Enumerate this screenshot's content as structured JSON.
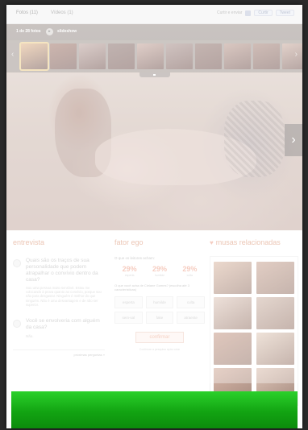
{
  "tabs": {
    "photos": "Fotos (11)",
    "videos": "Vídeos (1)"
  },
  "share": {
    "label": "Curtir e enviar",
    "like": "Curtir",
    "share": "Tweet"
  },
  "gallery": {
    "counter": "1 de 28 fotos",
    "slideshow": "slideshow",
    "prev_icon": "chevron-left-icon",
    "next_icon": "chevron-right-icon",
    "thumb_colors": [
      "#e8c29d",
      "#b28e83",
      "#c7b2ad",
      "#9f8a86",
      "#cfb4ab",
      "#b7a39f",
      "#a58d87",
      "#c6aaa0",
      "#b79a90",
      "#d3b9ae"
    ]
  },
  "interview": {
    "title": "entrevista",
    "q1": "Quais são os traços de sua personalidade que podem atrapalhar o convívio dentro da casa?",
    "a1": "Sou uma pessoa muito sensível. Estou me colocando à prova quanto ao convívio, porque sou não para desgastar. Ninguém é melhor do que ninguém. Não é uma desvantagem e de não ser superior.",
    "q2": "Você se envolveria com alguém da casa?",
    "a2": "Não.",
    "footer_left": "",
    "footer_link": "próximas perguntas »"
  },
  "ego": {
    "title": "fator ego",
    "question": "O que os leitores acham:",
    "pcts": [
      {
        "value": "29%",
        "label": "esperta"
      },
      {
        "value": "29%",
        "label": "humilde"
      },
      {
        "value": "29%",
        "label": "culta"
      }
    ],
    "question2": "O que você acha de Cleiane Gomes? (escolha até 3 características)",
    "options": [
      "esperta",
      "humilde",
      "culta",
      "sem-sal",
      "fake",
      "atraente"
    ],
    "confirm": "confirmar",
    "note": "Continuar a pesquisa após votar"
  },
  "musas": {
    "title": "musas relacionadas",
    "thumb_colors": [
      "#e1c4b2",
      "#d2b3a4",
      "#e4d0c5",
      "#d6c1b5",
      "#cfa999",
      "#e6d3c4",
      "#d9b8a9",
      "#e0c8ba"
    ]
  },
  "colors": {
    "accent": "#e2a88e",
    "banner": "#18b018"
  }
}
